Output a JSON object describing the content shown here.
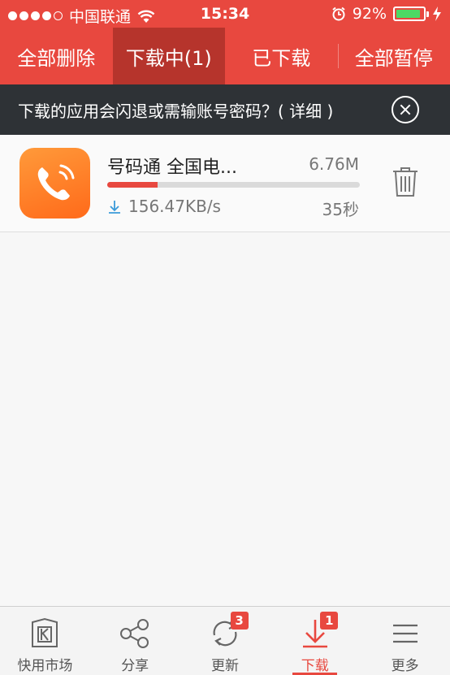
{
  "status": {
    "carrier": "中国联通",
    "time": "15:34",
    "battery": "92%",
    "battery_level": 0.92
  },
  "tabs": [
    {
      "label": "全部删除"
    },
    {
      "label": "下载中(1)"
    },
    {
      "label": "已下载"
    },
    {
      "label": "全部暂停"
    }
  ],
  "notice": {
    "text": "下载的应用会闪退或需输账号密码？( 详细 )"
  },
  "download": {
    "name": "号码通 全国电...",
    "size": "6.76M",
    "speed": "156.47KB/s",
    "time_left": "35秒",
    "progress": 0.2
  },
  "bottom_nav": [
    {
      "label": "快用市场"
    },
    {
      "label": "分享"
    },
    {
      "label": "更新",
      "badge": "3"
    },
    {
      "label": "下载",
      "badge": "1"
    },
    {
      "label": "更多"
    }
  ],
  "colors": {
    "brand_red": "#e8483f",
    "active_tab": "#b6342c",
    "notice_bg": "#2e3236",
    "app_icon_orange": "#ff7a26"
  }
}
